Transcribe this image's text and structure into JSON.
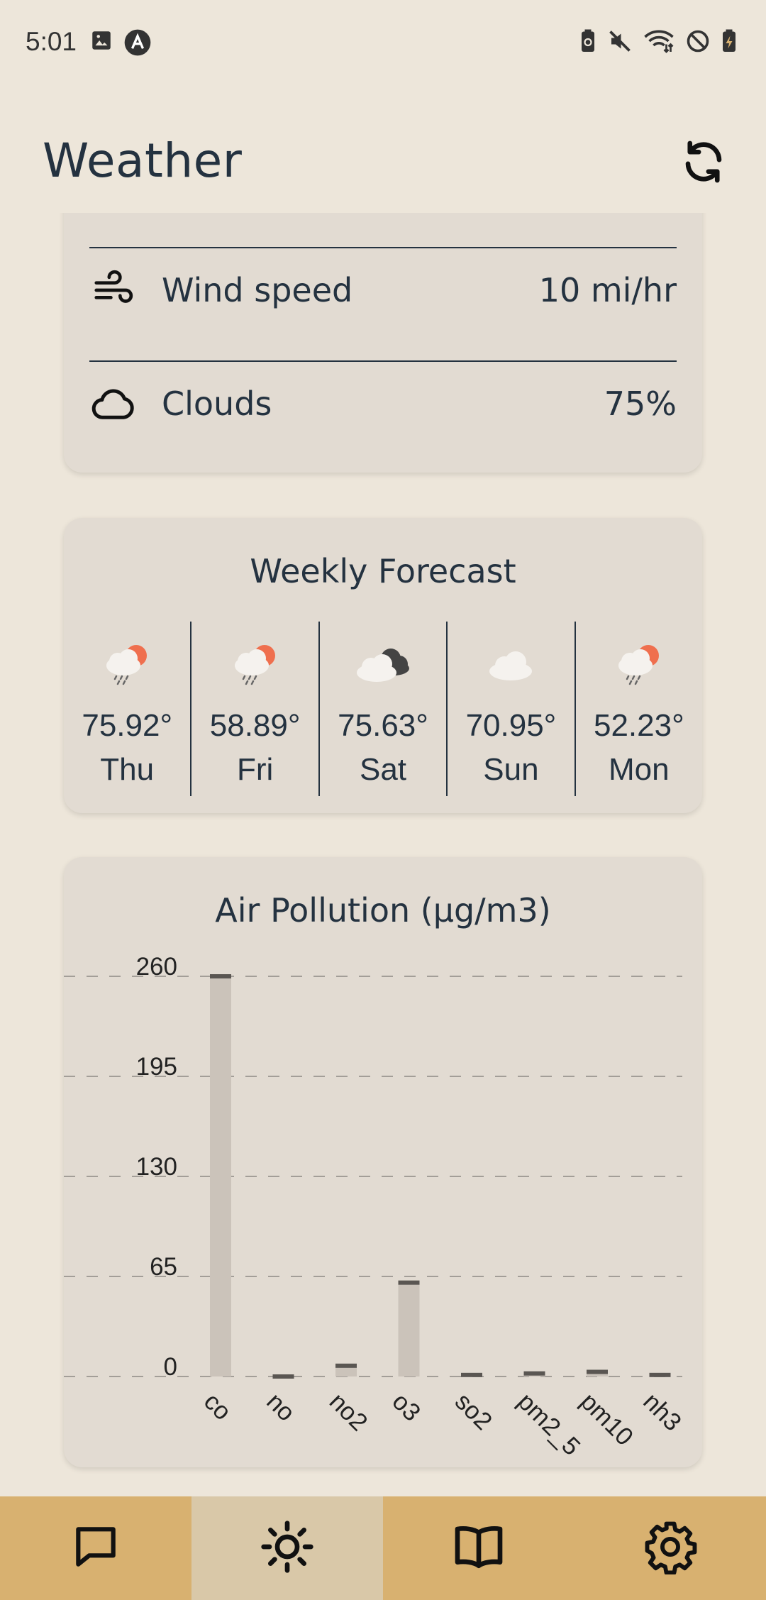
{
  "status_bar": {
    "time": "5:01",
    "left_icons": [
      "image-icon",
      "app-a-icon"
    ],
    "right_icons": [
      "battery-saver-icon",
      "mute-icon",
      "wifi-icon",
      "do-not-disturb-icon",
      "battery-charging-icon"
    ]
  },
  "app_bar": {
    "title": "Weather",
    "refresh_icon": "refresh-icon"
  },
  "details": {
    "items": [
      {
        "icon": "wind-icon",
        "label": "Wind speed",
        "value": "10 mi/hr"
      },
      {
        "icon": "cloud-icon",
        "label": "Clouds",
        "value": "75%"
      }
    ]
  },
  "forecast": {
    "title": "Weekly Forecast",
    "days": [
      {
        "day": "Thu",
        "temp": "75.92°",
        "icon": "sun-rain-cloud-icon"
      },
      {
        "day": "Fri",
        "temp": "58.89°",
        "icon": "sun-rain-cloud-icon"
      },
      {
        "day": "Sat",
        "temp": "75.63°",
        "icon": "dark-clouds-icon"
      },
      {
        "day": "Sun",
        "temp": "70.95°",
        "icon": "cloud-icon"
      },
      {
        "day": "Mon",
        "temp": "52.23°",
        "icon": "sun-rain-cloud-icon"
      }
    ]
  },
  "pollution": {
    "title": "Air Pollution (µg/m3)"
  },
  "chart_data": {
    "type": "bar",
    "title": "Air Pollution (µg/m3)",
    "categories": [
      "co",
      "no",
      "no2",
      "o3",
      "so2",
      "pm2_5",
      "pm10",
      "nh3"
    ],
    "values": [
      260,
      0,
      7,
      61,
      1,
      2,
      3,
      1
    ],
    "ylim": [
      0,
      260
    ],
    "yticks": [
      0,
      65,
      130,
      195,
      260
    ],
    "ytick_labels": [
      "0",
      "65",
      "130",
      "195",
      "260"
    ],
    "grid": true,
    "xlabel": "",
    "ylabel": "",
    "bar_color": "#cbc3ba",
    "cap_color": "#5a5652"
  },
  "bottom_nav": {
    "items": [
      {
        "icon": "chat-icon",
        "active": false
      },
      {
        "icon": "sun-icon",
        "active": true
      },
      {
        "icon": "book-icon",
        "active": false
      },
      {
        "icon": "gear-icon",
        "active": false
      }
    ]
  },
  "colors": {
    "background": "#ede6da",
    "card": "#e2dbd2",
    "text": "#243240",
    "nav": "#d8b170",
    "nav_active": "#d9c8a8"
  }
}
